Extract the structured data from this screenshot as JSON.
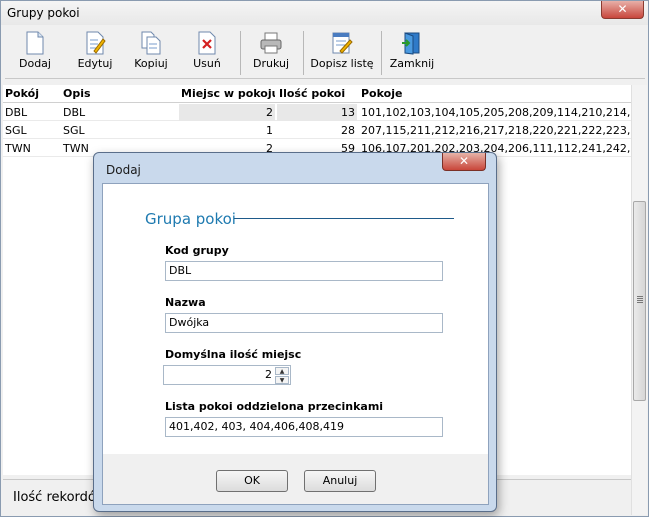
{
  "window": {
    "title": "Grupy pokoi",
    "close": "✕"
  },
  "toolbar": {
    "dodaj": "Dodaj",
    "edytuj": "Edytuj",
    "kopiuj": "Kopiuj",
    "usun": "Usuń",
    "drukuj": "Drukuj",
    "dopisz": "Dopisz listę",
    "zamknij": "Zamknij"
  },
  "grid": {
    "headers": {
      "pokoj": "Pokój",
      "opis": "Opis",
      "miejsc": "Miejsc w pokoju",
      "ilosc": "Ilość pokoi",
      "pokoje": "Pokoje"
    },
    "rows": [
      {
        "pokoj": "DBL",
        "opis": "DBL",
        "miejsc": "2",
        "ilosc": "13",
        "pokoje": "101,102,103,104,105,205,208,209,114,210,214,21..."
      },
      {
        "pokoj": "SGL",
        "opis": "SGL",
        "miejsc": "1",
        "ilosc": "28",
        "pokoje": "207,115,211,212,216,217,218,220,221,222,223,22..."
      },
      {
        "pokoj": "TWN",
        "opis": "TWN",
        "miejsc": "2",
        "ilosc": "59",
        "pokoje": "106,107,201,202,203,204,206,111,112,241,242,24..."
      }
    ]
  },
  "status": {
    "text": "Ilość rekordó"
  },
  "dialog": {
    "title": "Dodaj",
    "close": "✕",
    "group_title": "Grupa pokoi",
    "kod_label": "Kod grupy",
    "kod_value": "DBL",
    "nazwa_label": "Nazwa",
    "nazwa_value": "Dwójka",
    "ilosc_label": "Domyślna ilość miejsc",
    "ilosc_value": "2",
    "lista_label": "Lista pokoi oddzielona przecinkami",
    "lista_value": "401,402, 403, 404,406,408,419",
    "ok": "OK",
    "cancel": "Anuluj"
  },
  "icons": {
    "dodaj": "new-document-icon",
    "edytuj": "edit-document-icon",
    "kopiuj": "copy-document-icon",
    "usun": "delete-document-icon",
    "drukuj": "printer-icon",
    "dopisz": "append-list-icon",
    "zamknij": "exit-door-icon"
  },
  "colors": {
    "accent": "#1e7ab0",
    "dialog_frame": "#c9d9ec",
    "close_red": "#c9463a"
  }
}
